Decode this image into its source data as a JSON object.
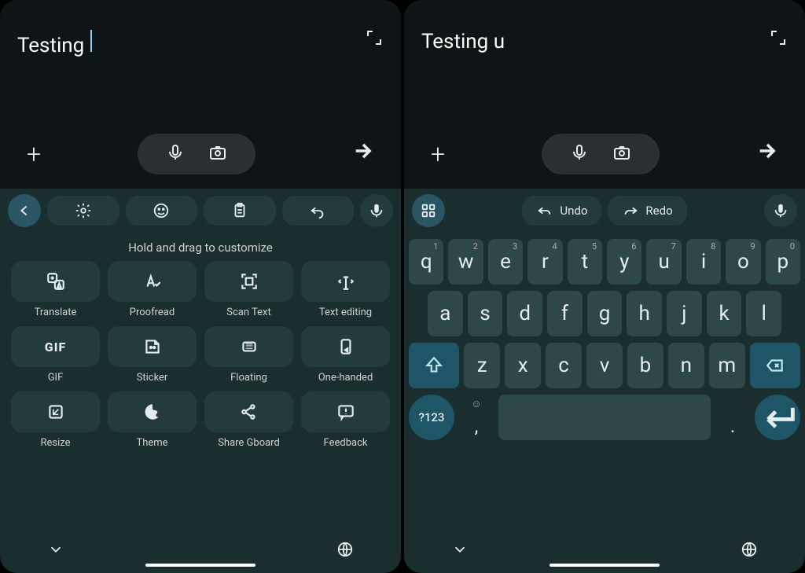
{
  "left": {
    "input_text": "Testing",
    "show_cursor": true,
    "toolbar": {
      "back_icon": "back-icon",
      "items": [
        "settings-icon",
        "emoji-icon",
        "clipboard-icon",
        "undo-icon"
      ],
      "mic_icon": "mic-icon"
    },
    "customize_hint": "Hold and drag to customize",
    "grid": [
      {
        "icon": "translate-icon",
        "label": "Translate"
      },
      {
        "icon": "proofread-icon",
        "label": "Proofread"
      },
      {
        "icon": "scan-icon",
        "label": "Scan Text"
      },
      {
        "icon": "textedit-icon",
        "label": "Text editing"
      },
      {
        "icon": "gif-icon",
        "label": "GIF"
      },
      {
        "icon": "sticker-icon",
        "label": "Sticker"
      },
      {
        "icon": "floating-icon",
        "label": "Floating"
      },
      {
        "icon": "onehand-icon",
        "label": "One-handed"
      },
      {
        "icon": "resize-icon",
        "label": "Resize"
      },
      {
        "icon": "theme-icon",
        "label": "Theme"
      },
      {
        "icon": "share-icon",
        "label": "Share Gboard"
      },
      {
        "icon": "feedback-icon",
        "label": "Feedback"
      }
    ]
  },
  "right": {
    "input_text": "Testing u",
    "toolbar": {
      "apps_icon": "apps-icon",
      "undo_label": "Undo",
      "redo_label": "Redo",
      "mic_icon": "mic-icon"
    },
    "rows": {
      "row1": [
        {
          "letter": "q",
          "num": "1"
        },
        {
          "letter": "w",
          "num": "2"
        },
        {
          "letter": "e",
          "num": "3"
        },
        {
          "letter": "r",
          "num": "4"
        },
        {
          "letter": "t",
          "num": "5"
        },
        {
          "letter": "y",
          "num": "6"
        },
        {
          "letter": "u",
          "num": "7"
        },
        {
          "letter": "i",
          "num": "8"
        },
        {
          "letter": "o",
          "num": "9"
        },
        {
          "letter": "p",
          "num": "0"
        }
      ],
      "row2": [
        "a",
        "s",
        "d",
        "f",
        "g",
        "h",
        "j",
        "k",
        "l"
      ],
      "row3": [
        "z",
        "x",
        "c",
        "v",
        "b",
        "n",
        "m"
      ]
    },
    "sym_key": "?123",
    "comma": ",",
    "period": "."
  }
}
